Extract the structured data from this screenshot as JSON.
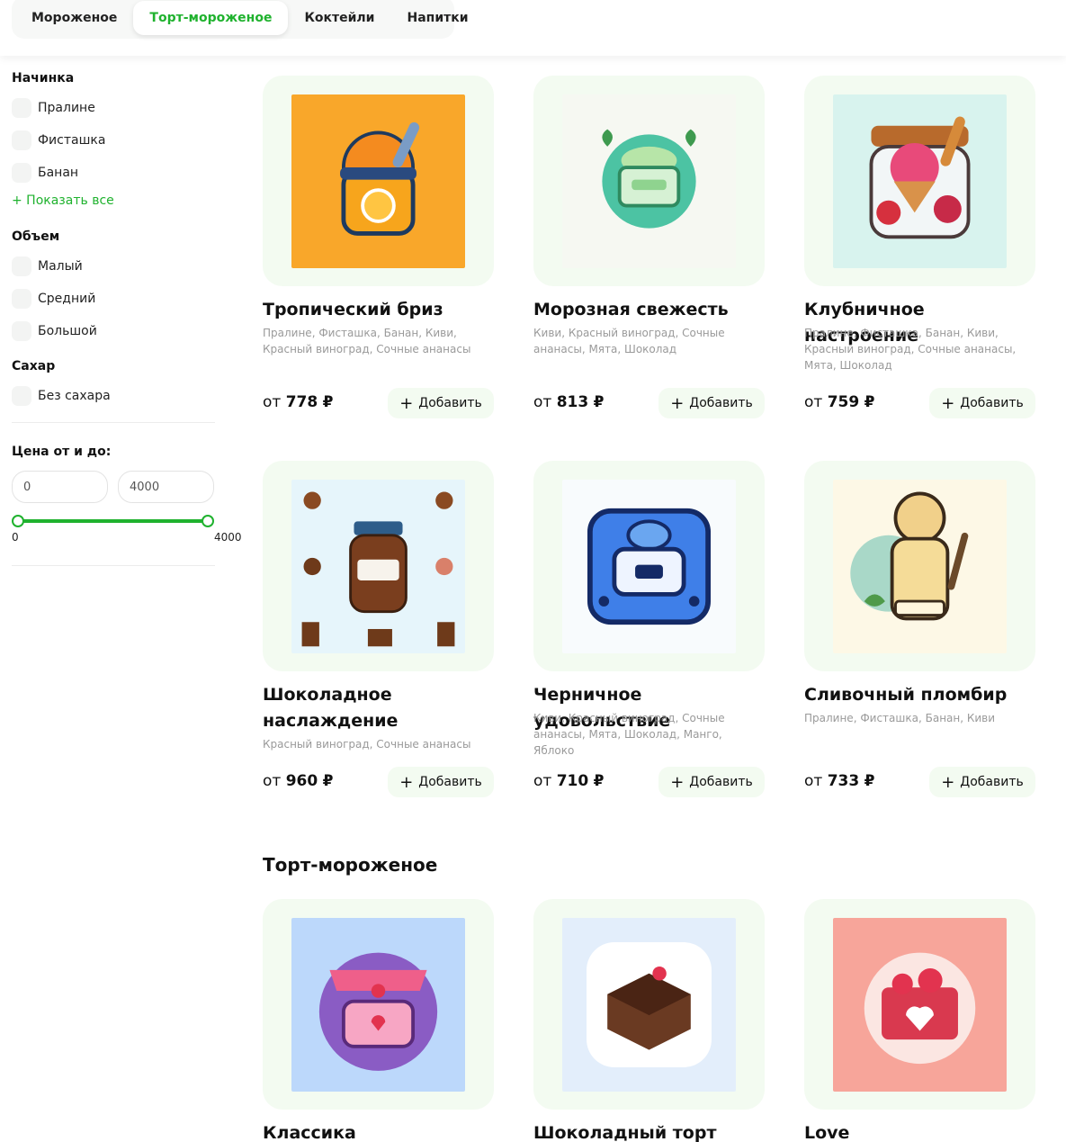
{
  "tabs": [
    "Мороженое",
    "Торт-мороженое",
    "Коктейли",
    "Напитки"
  ],
  "active_tab": 1,
  "filters": {
    "filling_title": "Начинка",
    "filling": [
      "Пралине",
      "Фисташка",
      "Банан"
    ],
    "show_all": "+ Показать все",
    "volume_title": "Объем",
    "volume": [
      "Малый",
      "Средний",
      "Большой"
    ],
    "sugar_title": "Сахар",
    "sugar": [
      "Без сахара"
    ],
    "price_title": "Цена от и до:",
    "price_from": "0",
    "price_to": "4000",
    "range_min_label": "0",
    "range_max_label": "4000"
  },
  "add_label": "Добавить",
  "price_prefix": "от",
  "currency": "₽",
  "products": [
    {
      "title": "Тропический бриз",
      "desc": "Пралине, Фисташка, Банан, Киви, Красный виноград, Сочные ананасы",
      "price": "778",
      "icon": "orange-jar-icon"
    },
    {
      "title": "Морозная свежесть",
      "desc": "Киви, Красный виноград, Сочные ананасы, Мята, Шоколад",
      "price": "813",
      "icon": "mint-jar-icon"
    },
    {
      "title": "Клубничное настроение",
      "desc": "Пралине, Фисташка, Банан, Киви, Красный виноград, Сочные ананасы, Мята, Шоколад",
      "price": "759",
      "icon": "strawberry-jar-icon"
    },
    {
      "title": "Шоколадное наслаждение",
      "desc": "Красный виноград, Сочные ананасы",
      "price": "960",
      "icon": "chocolate-jar-icon"
    },
    {
      "title": "Черничное удовольствие",
      "desc": "Киви, Красный виноград, Сочные ананасы, Мята, Шоколад, Манго, Яблоко",
      "price": "710",
      "icon": "blueberry-box-icon"
    },
    {
      "title": "Сливочный пломбир",
      "desc": "Пралине, Фисташка, Банан, Киви",
      "price": "733",
      "icon": "vanilla-jar-icon"
    }
  ],
  "section2_title": "Торт-мороженое",
  "cakes": [
    {
      "title": "Классика",
      "icon": "pink-cake-icon"
    },
    {
      "title": "Шоколадный торт",
      "icon": "chocolate-cake-icon"
    },
    {
      "title": "Love",
      "icon": "heart-cake-icon"
    }
  ],
  "colors": {
    "accent": "#1fb22e",
    "card_bg": "#f3fbf1"
  }
}
